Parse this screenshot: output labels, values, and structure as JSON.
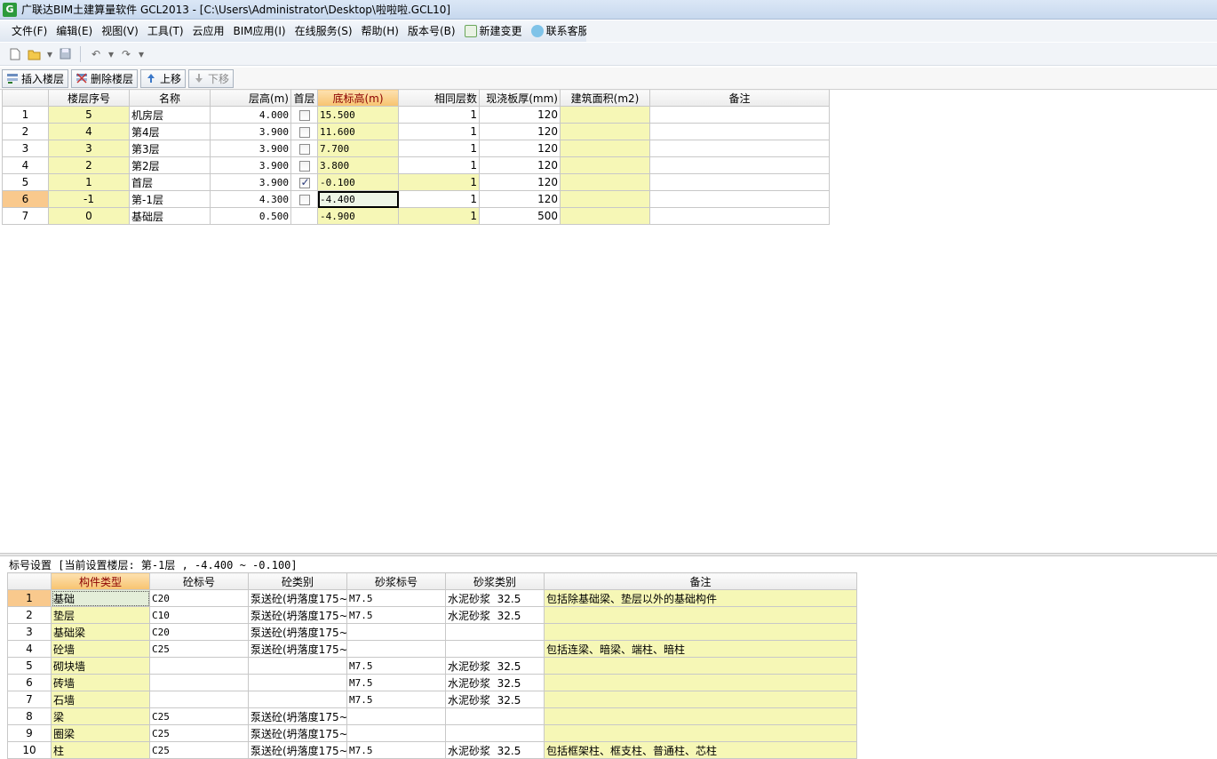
{
  "window": {
    "title": "广联达BIM土建算量软件 GCL2013 - [C:\\Users\\Administrator\\Desktop\\啦啦啦.GCL10]",
    "app_icon": "G"
  },
  "menu": [
    {
      "label": "文件(F)"
    },
    {
      "label": "编辑(E)"
    },
    {
      "label": "视图(V)"
    },
    {
      "label": "工具(T)"
    },
    {
      "label": "云应用"
    },
    {
      "label": "BIM应用(I)"
    },
    {
      "label": "在线服务(S)"
    },
    {
      "label": "帮助(H)"
    },
    {
      "label": "版本号(B)"
    },
    {
      "label": "新建变更"
    },
    {
      "label": "联系客服"
    }
  ],
  "floor_toolbar": {
    "insert": "插入楼层",
    "delete": "删除楼层",
    "up": "上移",
    "down": "下移"
  },
  "floor_grid": {
    "headers": [
      "楼层序号",
      "名称",
      "层高(m)",
      "首层",
      "底标高(m)",
      "相同层数",
      "现浇板厚(mm)",
      "建筑面积(m2)",
      "备注"
    ],
    "rows": [
      {
        "n": "1",
        "seq": "5",
        "name": "机房层",
        "h": "4.000",
        "first": false,
        "elev": "15.500",
        "same": "1",
        "slab": "120",
        "area": "",
        "note": ""
      },
      {
        "n": "2",
        "seq": "4",
        "name": "第4层",
        "h": "3.900",
        "first": false,
        "elev": "11.600",
        "same": "1",
        "slab": "120",
        "area": "",
        "note": ""
      },
      {
        "n": "3",
        "seq": "3",
        "name": "第3层",
        "h": "3.900",
        "first": false,
        "elev": "7.700",
        "same": "1",
        "slab": "120",
        "area": "",
        "note": ""
      },
      {
        "n": "4",
        "seq": "2",
        "name": "第2层",
        "h": "3.900",
        "first": false,
        "elev": "3.800",
        "same": "1",
        "slab": "120",
        "area": "",
        "note": ""
      },
      {
        "n": "5",
        "seq": "1",
        "name": "首层",
        "h": "3.900",
        "first": true,
        "elev": "-0.100",
        "same": "1",
        "slab": "120",
        "area": "",
        "note": ""
      },
      {
        "n": "6",
        "seq": "-1",
        "name": "第-1层",
        "h": "4.300",
        "first": false,
        "elev": "-4.400",
        "same": "1",
        "slab": "120",
        "area": "",
        "note": ""
      },
      {
        "n": "7",
        "seq": "0",
        "name": "基础层",
        "h": "0.500",
        "first": null,
        "elev": "-4.900",
        "same": "1",
        "slab": "500",
        "area": "",
        "note": ""
      }
    ]
  },
  "lower": {
    "label": "标号设置 [当前设置楼层: 第-1层 , -4.400 ~ -0.100]",
    "headers": [
      "构件类型",
      "砼标号",
      "砼类别",
      "砂浆标号",
      "砂浆类别",
      "备注"
    ],
    "rows": [
      {
        "n": "1",
        "type": "基础",
        "grade": "C20",
        "cat": "泵送砼(坍落度175~",
        "mortar": "M7.5",
        "mcat": "水泥砂浆  32.5",
        "note": "包括除基础梁、垫层以外的基础构件"
      },
      {
        "n": "2",
        "type": "垫层",
        "grade": "C10",
        "cat": "泵送砼(坍落度175~",
        "mortar": "M7.5",
        "mcat": "水泥砂浆  32.5",
        "note": ""
      },
      {
        "n": "3",
        "type": "基础梁",
        "grade": "C20",
        "cat": "泵送砼(坍落度175~",
        "mortar": "",
        "mcat": "",
        "note": ""
      },
      {
        "n": "4",
        "type": "砼墙",
        "grade": "C25",
        "cat": "泵送砼(坍落度175~",
        "mortar": "",
        "mcat": "",
        "note": "包括连梁、暗梁、端柱、暗柱"
      },
      {
        "n": "5",
        "type": "砌块墙",
        "grade": "",
        "cat": "",
        "mortar": "M7.5",
        "mcat": "水泥砂浆  32.5",
        "note": ""
      },
      {
        "n": "6",
        "type": "砖墙",
        "grade": "",
        "cat": "",
        "mortar": "M7.5",
        "mcat": "水泥砂浆  32.5",
        "note": ""
      },
      {
        "n": "7",
        "type": "石墙",
        "grade": "",
        "cat": "",
        "mortar": "M7.5",
        "mcat": "水泥砂浆  32.5",
        "note": ""
      },
      {
        "n": "8",
        "type": "梁",
        "grade": "C25",
        "cat": "泵送砼(坍落度175~",
        "mortar": "",
        "mcat": "",
        "note": ""
      },
      {
        "n": "9",
        "type": "圈梁",
        "grade": "C25",
        "cat": "泵送砼(坍落度175~",
        "mortar": "",
        "mcat": "",
        "note": ""
      },
      {
        "n": "10",
        "type": "柱",
        "grade": "C25",
        "cat": "泵送砼(坍落度175~",
        "mortar": "M7.5",
        "mcat": "水泥砂浆  32.5",
        "note": "包括框架柱、框支柱、普通柱、芯柱"
      }
    ]
  }
}
